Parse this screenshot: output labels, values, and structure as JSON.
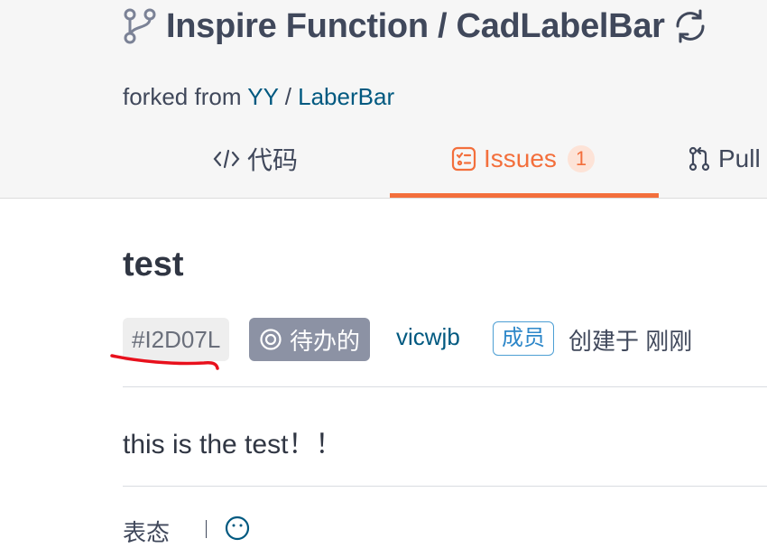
{
  "repo": {
    "owner": "Inspire Function",
    "separator": " / ",
    "name": "CadLabelBar",
    "forked_prefix": "forked from ",
    "forked_owner": "YY",
    "forked_sep": " / ",
    "forked_repo": "LaberBar"
  },
  "tabs": [
    {
      "label": "代码",
      "icon": "code-icon"
    },
    {
      "label": "Issues",
      "icon": "issues-icon",
      "count": "1",
      "active": true
    },
    {
      "label": "Pull",
      "icon": "pull-request-icon"
    }
  ],
  "issue": {
    "title": "test",
    "id": "#I2D07L",
    "state": "待办的",
    "author": "vicwjb",
    "role": "成员",
    "created": "创建于 刚刚",
    "body": "this is the test！！",
    "bottom_label": "表态"
  },
  "colors": {
    "accent": "#f36f3c",
    "link": "#005980",
    "state_badge": "#8c92a4",
    "annotation": "#e8101c"
  }
}
